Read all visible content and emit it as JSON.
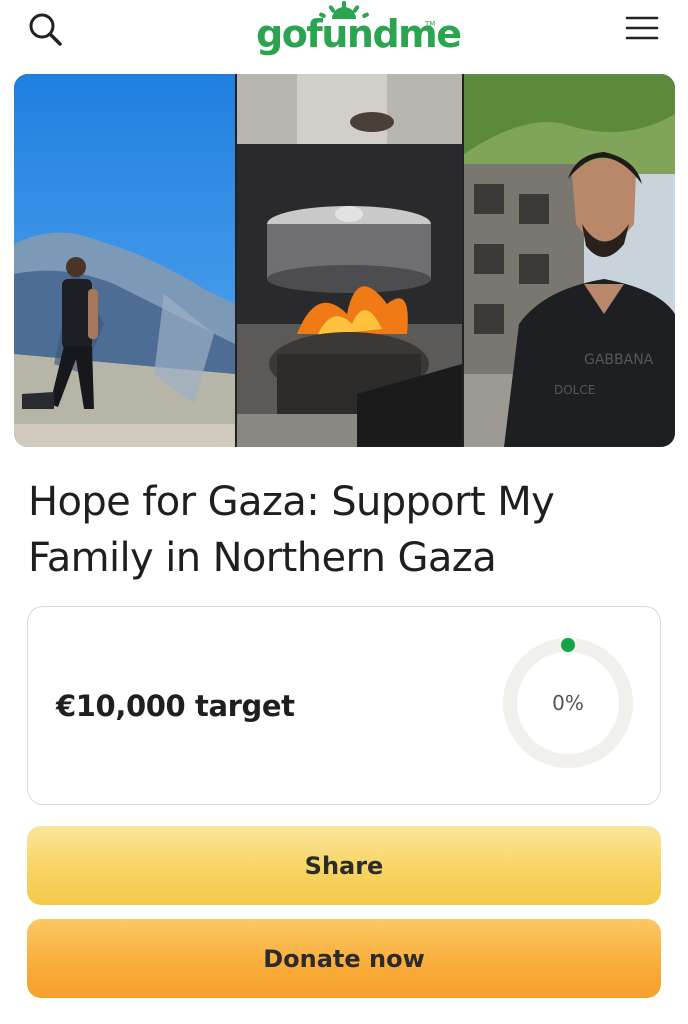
{
  "header": {
    "logo_text": "gofundme",
    "logo_tm": "TM",
    "search_icon": "search-icon",
    "menu_icon": "hamburger-menu-icon",
    "brand_color": "#2aa44f"
  },
  "gallery": {
    "photos": [
      "man-on-rubble-photo",
      "cooking-fire-photo",
      "man-portrait-photo"
    ]
  },
  "campaign": {
    "title_line1": "Hope for Gaza: Support My",
    "title_line2": "Family in Northern Gaza"
  },
  "target": {
    "amount_label": "€10,000 target",
    "progress_label": "0%",
    "progress_fraction": 0,
    "accent_color": "#15a34a"
  },
  "buttons": {
    "share_label": "Share",
    "donate_label": "Donate now"
  }
}
